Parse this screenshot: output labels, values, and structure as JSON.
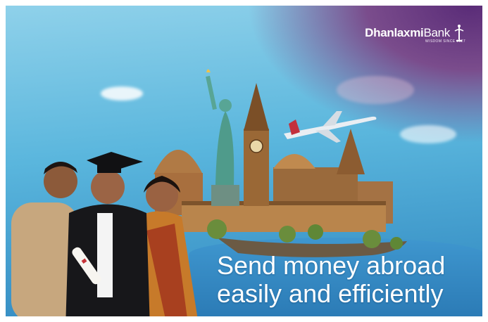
{
  "brand": {
    "name_bold": "Dhanlaxmi",
    "name_regular": "Bank",
    "tagline": "WISDOM SINCE 1927"
  },
  "headline": {
    "line1": "Send money abroad",
    "line2": "easily and efficiently"
  },
  "colors": {
    "sky_top": "#8fd1ea",
    "sky_bottom": "#2f86bf",
    "purple_tint": "#5a2c78",
    "text": "#ffffff"
  },
  "icons": {
    "logo_mark": "dhanlaxmi-emblem-icon"
  }
}
